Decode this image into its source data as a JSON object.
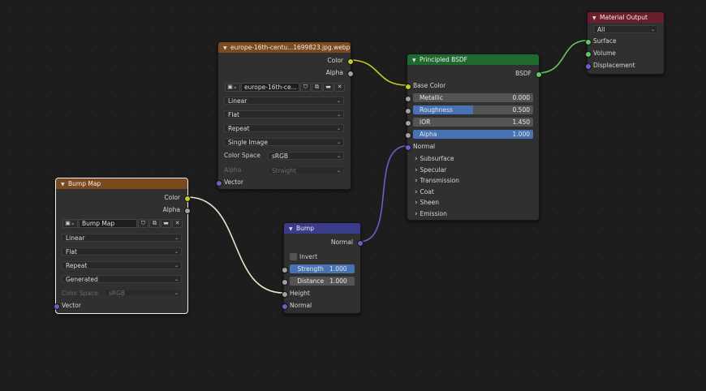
{
  "image_node": {
    "title": "europe-16th-centu...1699823.jpg.webp",
    "out_color": "Color",
    "out_alpha": "Alpha",
    "image_name": "europe-16th-ce...",
    "interpolation": "Linear",
    "projection": "Flat",
    "extension": "Repeat",
    "source": "Single Image",
    "color_space_label": "Color Space",
    "color_space": "sRGB",
    "alpha_label": "Alpha",
    "alpha_mode": "Straight",
    "in_vector": "Vector"
  },
  "bump_map_node": {
    "title": "Bump Map",
    "out_color": "Color",
    "out_alpha": "Alpha",
    "image_name": "Bump Map",
    "interpolation": "Linear",
    "projection": "Flat",
    "extension": "Repeat",
    "source": "Generated",
    "color_space_label": "Color Space",
    "color_space": "sRGB",
    "in_vector": "Vector"
  },
  "bump_node": {
    "title": "Bump",
    "out_normal": "Normal",
    "invert": "Invert",
    "strength_label": "Strength",
    "strength_value": "1.000",
    "distance_label": "Distance",
    "distance_value": "1.000",
    "in_height": "Height",
    "in_normal": "Normal"
  },
  "bsdf_node": {
    "title": "Principled BSDF",
    "out_bsdf": "BSDF",
    "base_color": "Base Color",
    "metallic_label": "Metallic",
    "metallic_value": "0.000",
    "roughness_label": "Roughness",
    "roughness_value": "0.500",
    "roughness_fraction": 0.5,
    "ior_label": "IOR",
    "ior_value": "1.450",
    "alpha_label": "Alpha",
    "alpha_value": "1.000",
    "normal": "Normal",
    "panels": [
      "Subsurface",
      "Specular",
      "Transmission",
      "Coat",
      "Sheen",
      "Emission"
    ]
  },
  "output_node": {
    "title": "Material Output",
    "target": "All",
    "in_surface": "Surface",
    "in_volume": "Volume",
    "in_displacement": "Displacement"
  },
  "colors": {
    "texture_header": "#7b4a1e",
    "shader_header": "#1f6a2e",
    "output_header": "#6a1e2c",
    "vector_header": "#3b3b8c",
    "color_socket": "#c7c729",
    "float_socket": "#a1a1a1",
    "vector_socket": "#6363c7",
    "shader_socket": "#63c763",
    "slider_fill": "#4772b3"
  }
}
